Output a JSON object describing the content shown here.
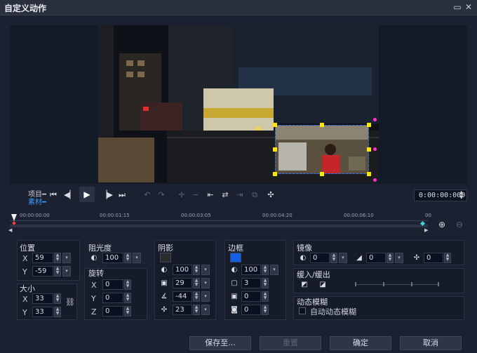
{
  "window": {
    "title": "自定义动作",
    "restore_icon": "restore-icon",
    "close_icon": "close-icon"
  },
  "transport": {
    "mode_project": "项目",
    "mode_clip": "素材",
    "timecode": "0:00:00:000"
  },
  "ruler": {
    "ticks": [
      "00:00:00:00",
      "00:00:01:15",
      "00:00:03:05",
      "00:00:04:20",
      "00:00:06:10",
      "00"
    ]
  },
  "position": {
    "title": "位置",
    "x_label": "X",
    "x": "59",
    "y_label": "Y",
    "y": "-59"
  },
  "size": {
    "title": "大小",
    "x_label": "X",
    "x": "33",
    "y_label": "Y",
    "y": "33"
  },
  "opacity": {
    "title": "阻光度",
    "value": "100"
  },
  "rotation": {
    "title": "旋转",
    "x_label": "X",
    "x": "0",
    "y_label": "Y",
    "y": "0",
    "z_label": "Z",
    "z": "0"
  },
  "shadow": {
    "title": "阴影",
    "color": "#2b2b2b",
    "opacity": "100",
    "blur": "29",
    "angle": "-44",
    "distance": "23"
  },
  "border": {
    "title": "边框",
    "color": "#1560e8",
    "opacity": "100",
    "width": "3",
    "v1": "0",
    "v2": "0"
  },
  "mirror": {
    "title": "镜像",
    "v1": "0",
    "v2": "0",
    "v3": "0"
  },
  "ease": {
    "title": "缓入/缓出"
  },
  "motion_blur": {
    "title": "动态模糊",
    "auto_label": "自动动态模糊",
    "auto_checked": false
  },
  "footer": {
    "save_as": "保存至...",
    "reset": "重置",
    "ok": "确定",
    "cancel": "取消"
  }
}
